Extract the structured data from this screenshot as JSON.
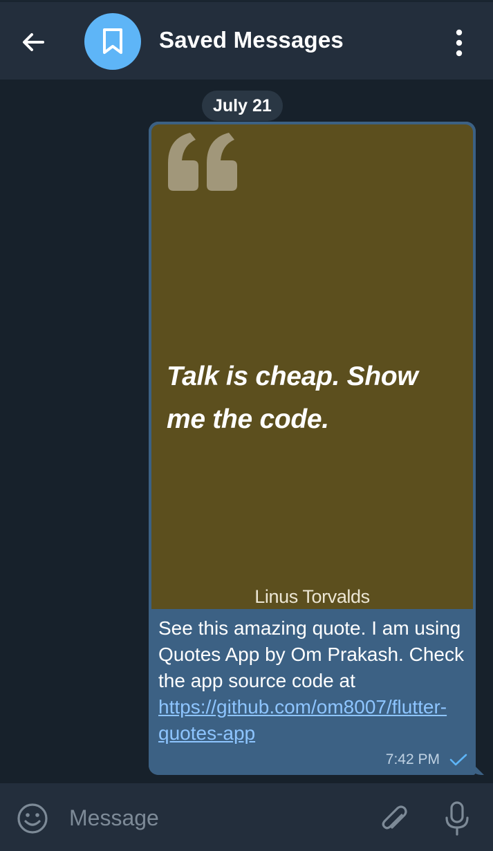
{
  "header": {
    "title": "Saved Messages",
    "icons": {
      "back": "arrow-left-icon",
      "avatar": "bookmark-icon",
      "menu": "more-vertical-icon"
    }
  },
  "chat": {
    "date_label": "July 21",
    "message": {
      "image": {
        "quote": "Talk is cheap. Show me the code.",
        "author": "Linus Torvalds",
        "background_color": "#5c4f1e"
      },
      "text_before_link": "See this amazing quote. I am using Quotes App by Om Prakash. Check the app source code at ",
      "link": "https://github.com/om8007/flutter-quotes-app",
      "time": "7:42 PM",
      "status": "sent-check-icon"
    }
  },
  "composer": {
    "placeholder": "Message",
    "icons": {
      "emoji": "emoji-icon",
      "attach": "paperclip-icon",
      "mic": "microphone-icon"
    }
  },
  "colors": {
    "background": "#17212b",
    "header": "#232e3c",
    "bubble": "#3c6184",
    "link": "#8ec5ff",
    "avatar": "#5eb5f7"
  }
}
